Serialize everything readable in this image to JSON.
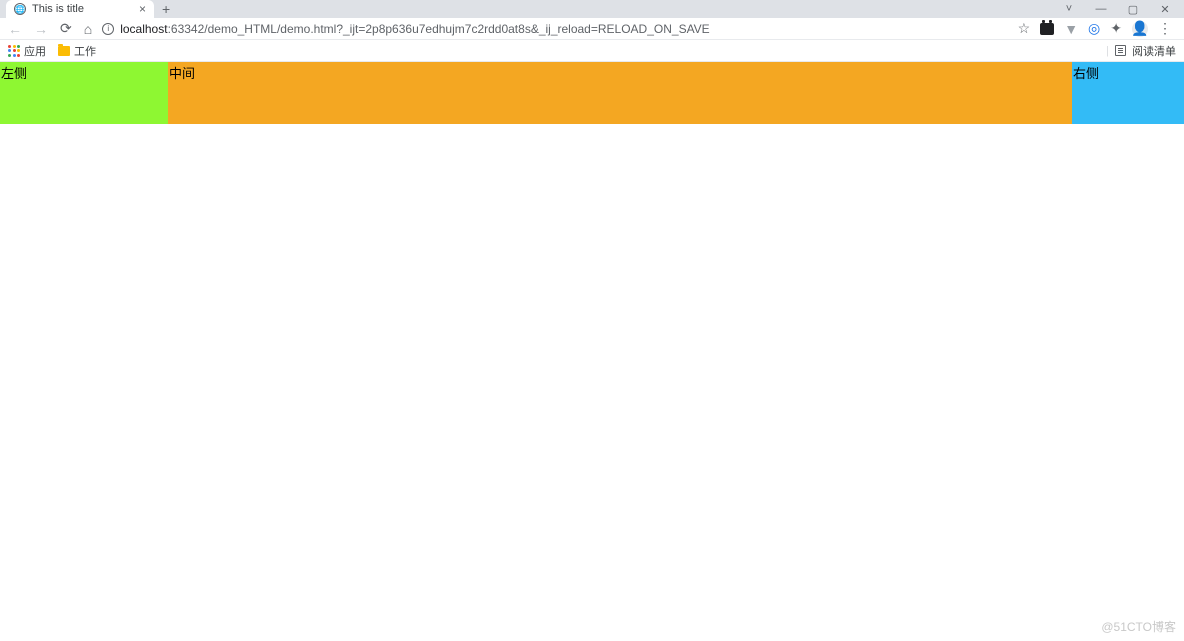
{
  "browser": {
    "tab": {
      "title": "This is title"
    },
    "url": {
      "host": "localhost",
      "port": ":63342",
      "path": "/demo_HTML/demo.html?_ijt=2p8p636u7edhujm7c2rdd0at8s&_ij_reload=RELOAD_ON_SAVE"
    },
    "bookmarks": {
      "apps": "应用",
      "folder1": "工作"
    },
    "reading_list": "阅读清单"
  },
  "page": {
    "left": "左侧",
    "middle": "中间",
    "right": "右侧"
  },
  "watermark": "@51CTO博客"
}
